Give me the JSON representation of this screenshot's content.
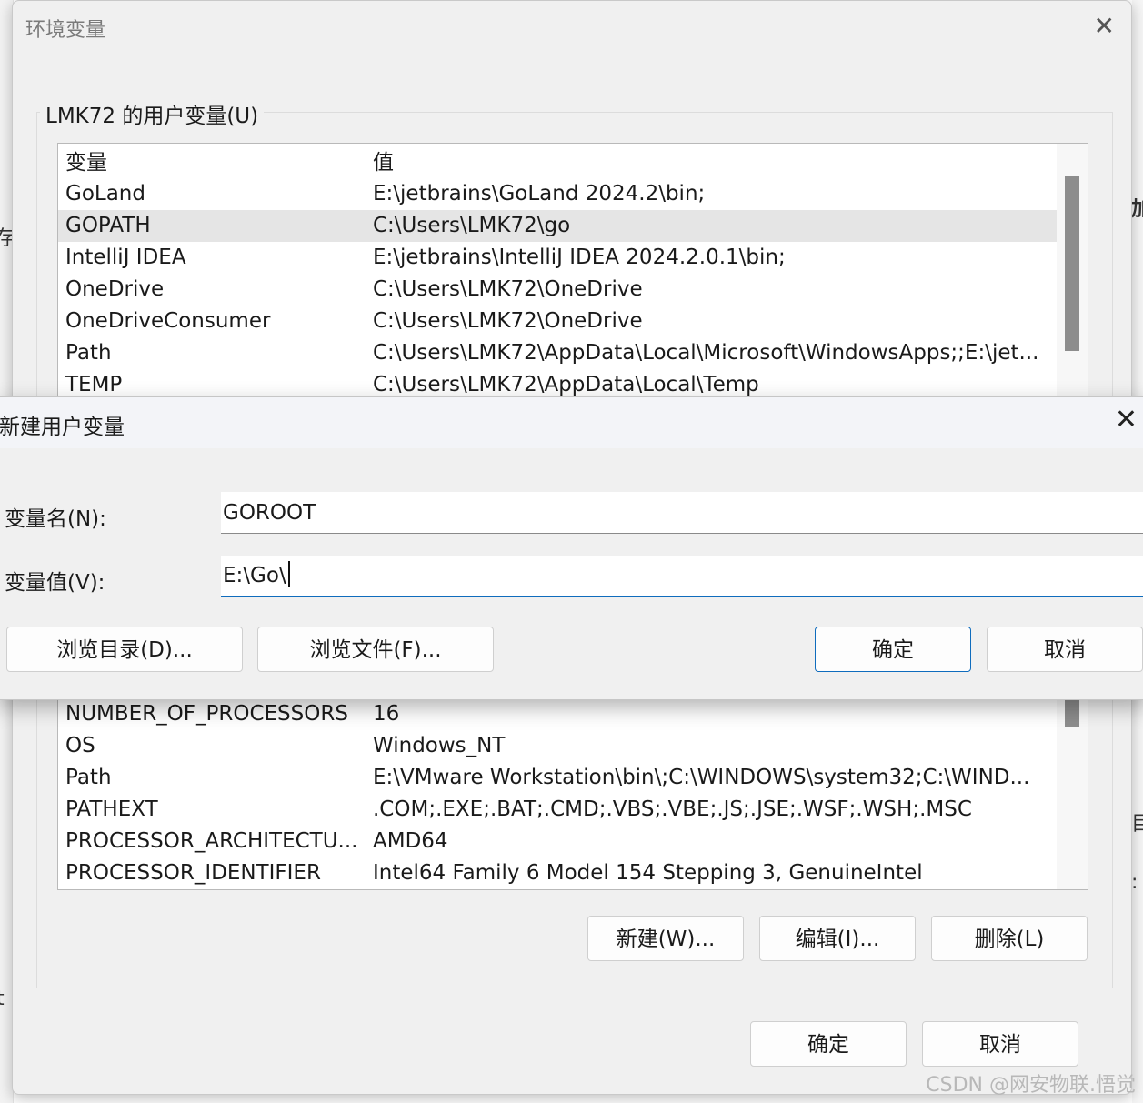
{
  "background_fragments": {
    "left_glyph_1": "存",
    "left_glyph_2": "t",
    "right_glyph_1": "加",
    "right_glyph_2": "目",
    "right_glyph_3": ":"
  },
  "env_dialog": {
    "title": "环境变量",
    "user_vars": {
      "legend": "LMK72 的用户变量(U)",
      "headers": [
        "变量",
        "值"
      ],
      "rows": [
        {
          "name": "GoLand",
          "value": "E:\\jetbrains\\GoLand 2024.2\\bin;"
        },
        {
          "name": "GOPATH",
          "value": "C:\\Users\\LMK72\\go"
        },
        {
          "name": "IntelliJ IDEA",
          "value": "E:\\jetbrains\\IntelliJ IDEA 2024.2.0.1\\bin;"
        },
        {
          "name": "OneDrive",
          "value": "C:\\Users\\LMK72\\OneDrive"
        },
        {
          "name": "OneDriveConsumer",
          "value": "C:\\Users\\LMK72\\OneDrive"
        },
        {
          "name": "Path",
          "value": "C:\\Users\\LMK72\\AppData\\Local\\Microsoft\\WindowsApps;;E:\\jet..."
        },
        {
          "name": "TEMP",
          "value": "C:\\Users\\LMK72\\AppData\\Local\\Temp"
        }
      ],
      "selected_index": 1
    },
    "system_vars": {
      "rows": [
        {
          "name": "NUMBER_OF_PROCESSORS",
          "value": "16"
        },
        {
          "name": "OS",
          "value": "Windows_NT"
        },
        {
          "name": "Path",
          "value": "E:\\VMware Workstation\\bin\\;C:\\WINDOWS\\system32;C:\\WIND..."
        },
        {
          "name": "PATHEXT",
          "value": ".COM;.EXE;.BAT;.CMD;.VBS;.VBE;.JS;.JSE;.WSF;.WSH;.MSC"
        },
        {
          "name": "PROCESSOR_ARCHITECTU...",
          "value": "AMD64"
        },
        {
          "name": "PROCESSOR_IDENTIFIER",
          "value": "Intel64 Family 6 Model 154 Stepping 3, GenuineIntel"
        }
      ],
      "buttons": {
        "new": "新建(W)...",
        "edit": "编辑(I)...",
        "delete": "删除(L)"
      }
    },
    "ok": "确定",
    "cancel": "取消"
  },
  "new_var_dialog": {
    "title": "新建用户变量",
    "name_label": "变量名(N):",
    "value_label": "变量值(V):",
    "name_value": "GOROOT",
    "value_value": "E:\\Go\\",
    "browse_dir": "浏览目录(D)...",
    "browse_file": "浏览文件(F)...",
    "ok": "确定",
    "cancel": "取消",
    "accent": "#0f6cbd"
  },
  "watermark": "CSDN @网安物联.悟觉"
}
